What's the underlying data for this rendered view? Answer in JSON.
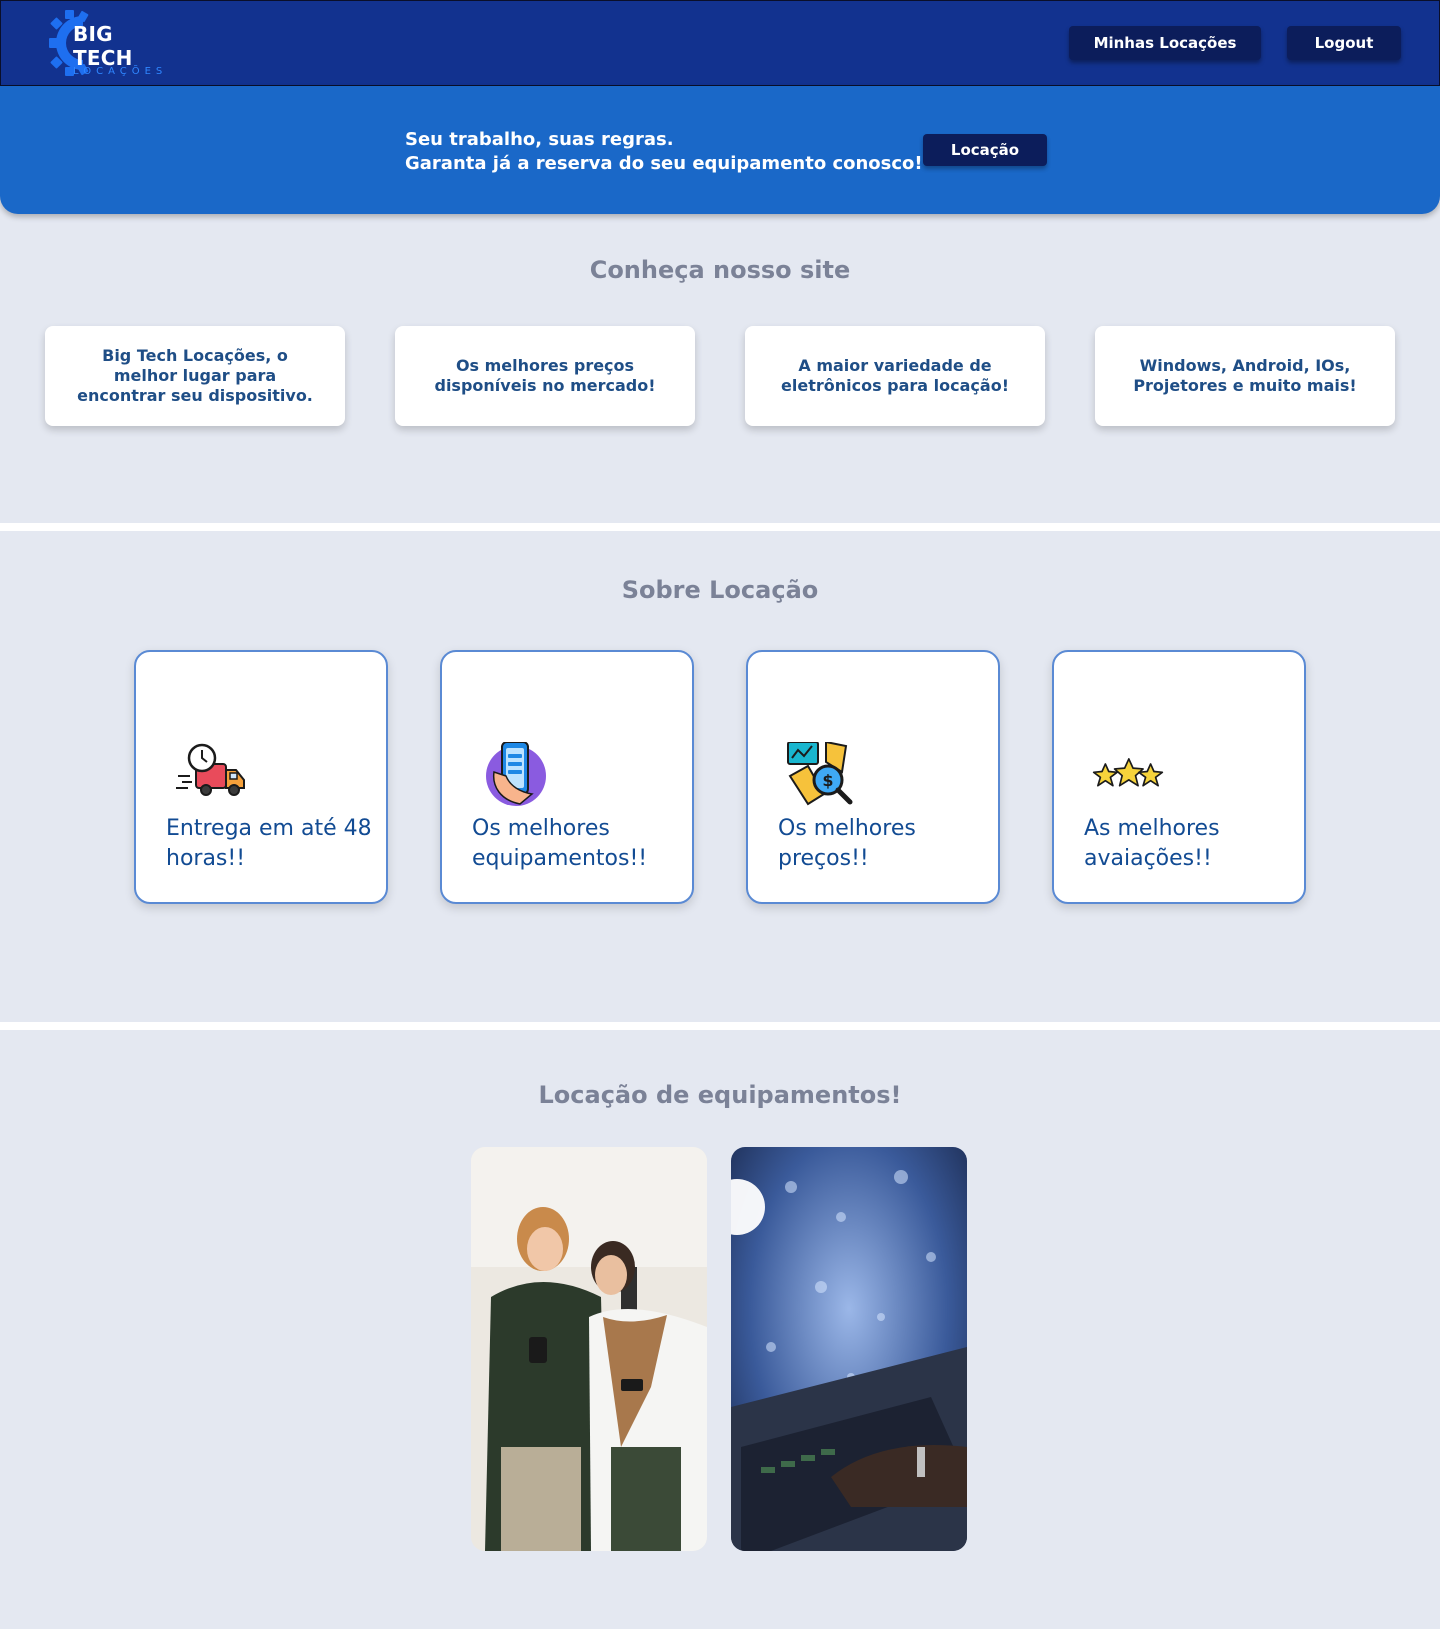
{
  "header": {
    "logo_title": "BIG TECH",
    "logo_subtitle": "LOCAÇÕES",
    "nav": [
      "Minhas Locações",
      "Logout"
    ]
  },
  "hero": {
    "line1": "Seu trabalho, suas regras.",
    "line2": "Garanta já a reserva do seu equipamento conosco!",
    "button": "Locação"
  },
  "site": {
    "title": "Conheça nosso site",
    "cards": [
      "Big Tech Locações, o melhor lugar para encontrar seu dispositivo.",
      "Os melhores preços disponíveis no mercado!",
      "A maior variedade de eletrônicos para locação!",
      "Windows, Android, IOs, Projetores e muito mais!"
    ]
  },
  "about": {
    "title": "Sobre Locação",
    "cards": [
      {
        "icon": "delivery-truck-icon",
        "text": "Entrega em até 48 horas!!"
      },
      {
        "icon": "smartphone-icon",
        "text": "Os melhores equipamentos!!"
      },
      {
        "icon": "price-analysis-icon",
        "text": "Os melhores preços!!"
      },
      {
        "icon": "stars-rating-icon",
        "text": "As melhores avaiações!!"
      }
    ]
  },
  "equipment": {
    "title": "Locação de equipamentos!"
  },
  "colors": {
    "header_bg": "#12328f",
    "hero_bg": "#1a68c8",
    "button_bg": "#0c1d5b",
    "page_bg": "#e4e8f1",
    "card_text": "#1f4e86",
    "feature_text": "#124b93",
    "feature_border": "#5a8ad4"
  }
}
